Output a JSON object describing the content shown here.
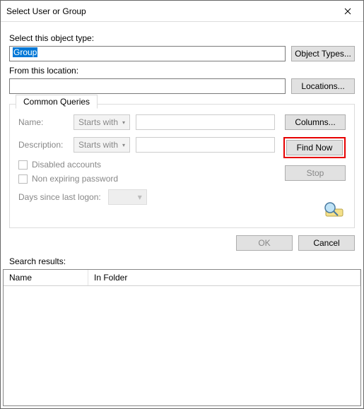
{
  "window": {
    "title": "Select User or Group"
  },
  "objectType": {
    "label": "Select this object type:",
    "value": "Group",
    "button": "Object Types..."
  },
  "location": {
    "label": "From this location:",
    "value": "",
    "button": "Locations..."
  },
  "queries": {
    "tab": "Common Queries",
    "nameLabel": "Name:",
    "descLabel": "Description:",
    "startsWith": "Starts with",
    "disabled": "Disabled accounts",
    "nonExpiring": "Non expiring password",
    "daysLabel": "Days since last logon:"
  },
  "side": {
    "columns": "Columns...",
    "findNow": "Find Now",
    "stop": "Stop"
  },
  "footer": {
    "ok": "OK",
    "cancel": "Cancel"
  },
  "results": {
    "label": "Search results:",
    "cols": {
      "name": "Name",
      "folder": "In Folder"
    }
  }
}
